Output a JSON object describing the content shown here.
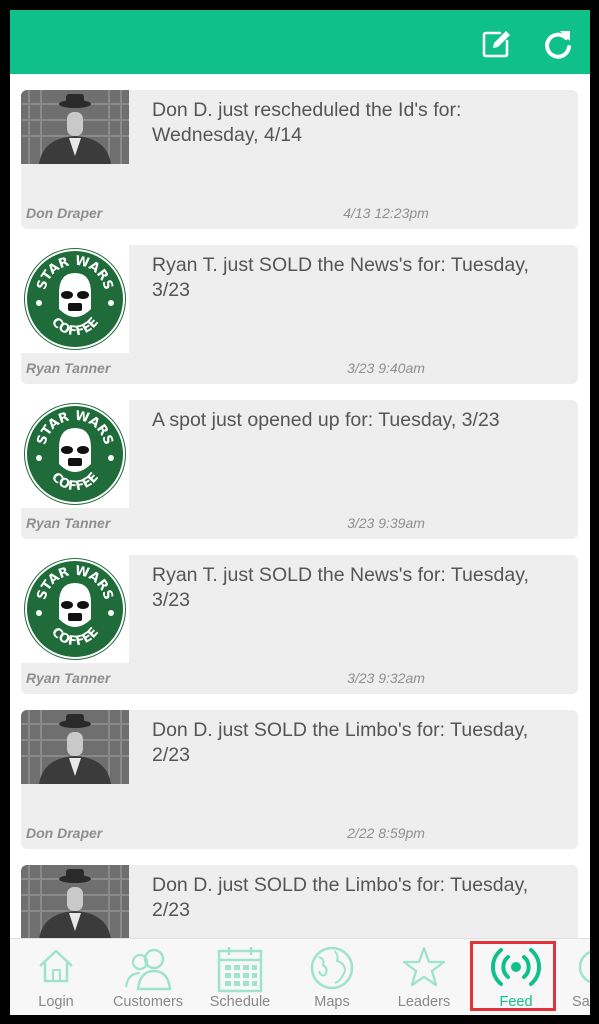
{
  "colors": {
    "accent": "#0fc08b",
    "highlight": "#e0343a"
  },
  "header": {
    "icons": [
      "edit-icon",
      "refresh-icon"
    ]
  },
  "feed": [
    {
      "avatar": "man-in-hat-photo",
      "message": "Don D. just rescheduled the Id's for: Wednesday, 4/14",
      "author": "Don Draper",
      "time": "4/13 12:23pm"
    },
    {
      "avatar": "star-wars-coffee-logo",
      "message": "Ryan T. just SOLD the News's for: Tuesday, 3/23",
      "author": "Ryan Tanner",
      "time": "3/23 9:40am"
    },
    {
      "avatar": "star-wars-coffee-logo",
      "message": "A spot just opened up for: Tuesday, 3/23",
      "author": "Ryan Tanner",
      "time": "3/23 9:39am"
    },
    {
      "avatar": "star-wars-coffee-logo",
      "message": "Ryan T. just SOLD the News's for: Tuesday, 3/23",
      "author": "Ryan Tanner",
      "time": "3/23 9:32am"
    },
    {
      "avatar": "man-in-hat-photo",
      "message": "Don D. just SOLD the Limbo's for: Tuesday, 2/23",
      "author": "Don Draper",
      "time": "2/22 8:59pm"
    },
    {
      "avatar": "man-in-hat-photo",
      "message": "Don D. just SOLD the Limbo's for: Tuesday, 2/23",
      "author": "",
      "time": ""
    }
  ],
  "logo": {
    "line1": "STAR WARS",
    "line2": "COFFEE"
  },
  "tabs": [
    {
      "label": "Login",
      "icon": "home-icon"
    },
    {
      "label": "Customers",
      "icon": "users-icon"
    },
    {
      "label": "Schedule",
      "icon": "calendar-icon"
    },
    {
      "label": "Maps",
      "icon": "globe-icon"
    },
    {
      "label": "Leaders",
      "icon": "star-icon"
    },
    {
      "label": "Feed",
      "icon": "broadcast-icon",
      "active": true
    },
    {
      "label": "Sale",
      "icon": "sales-icon"
    }
  ]
}
